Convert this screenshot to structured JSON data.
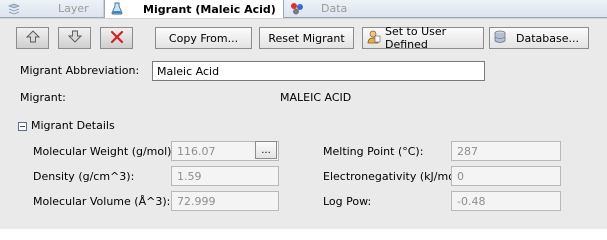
{
  "tabs": [
    {
      "label": "Layer",
      "icon": "layer-icon",
      "active": false
    },
    {
      "label": "Migrant (Maleic Acid)",
      "icon": "flask-icon",
      "active": true
    },
    {
      "label": "Data",
      "icon": "data-icon",
      "active": false
    }
  ],
  "toolbar": {
    "up_icon": "arrow-up-icon",
    "down_icon": "arrow-down-icon",
    "delete_icon": "red-x-icon",
    "copy_from_label": "Copy From...",
    "reset_label": "Reset Migrant",
    "set_user_label": "Set to User Defined",
    "database_label": "Database..."
  },
  "form": {
    "abbrev_label": "Migrant Abbreviation:",
    "abbrev_value": "Maleic Acid",
    "migrant_label": "Migrant:",
    "migrant_value": "MALEIC ACID"
  },
  "details": {
    "section_label": "Migrant Details",
    "expanded": true,
    "mw_label": "Molecular Weight (g/mol):",
    "mw_value": "116.07",
    "mw_button": "...",
    "density_label": "Density (g/cm^3):",
    "density_value": "1.59",
    "volume_label": "Molecular Volume (Å^3):",
    "volume_value": "72.999",
    "melting_label": "Melting Point (°C):",
    "melting_value": "287",
    "en_label": "Electronegativity (kJ/mol):",
    "en_value": "0",
    "logpow_label": "Log Pow:",
    "logpow_value": "-0.48"
  },
  "colors": {
    "delete_red": "#d62020",
    "tab_active_text": "#000000",
    "tab_inactive_text": "#9a9a9a"
  }
}
